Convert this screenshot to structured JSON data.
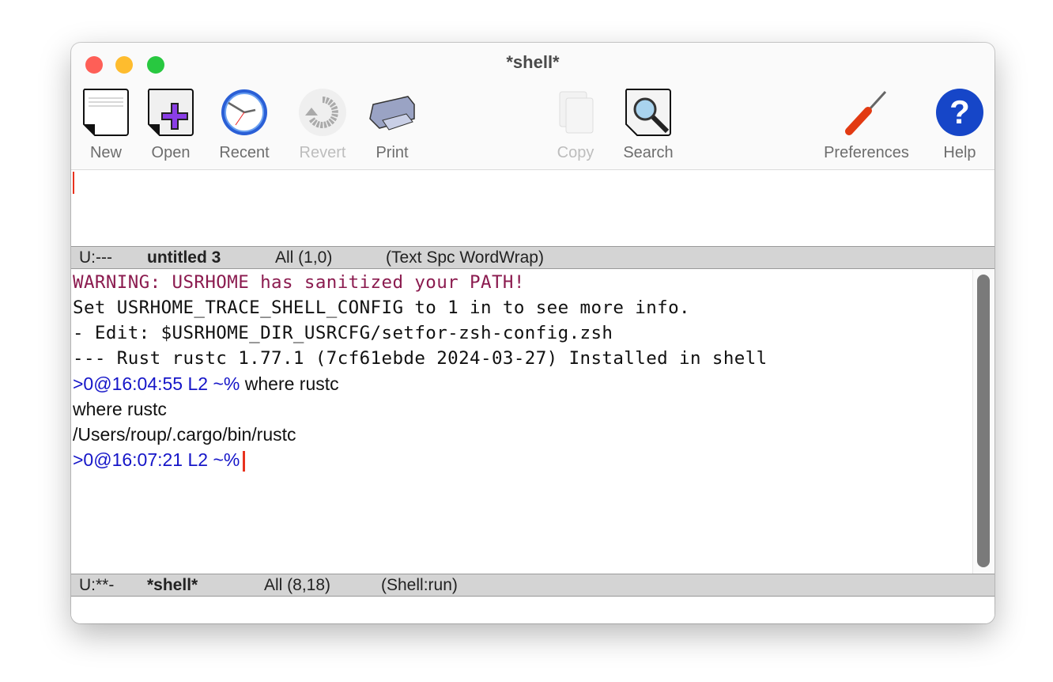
{
  "window": {
    "title": "*shell*"
  },
  "toolbar": {
    "items": [
      {
        "label": "New",
        "icon": "new-file-icon",
        "enabled": true
      },
      {
        "label": "Open",
        "icon": "open-file-icon",
        "enabled": true
      },
      {
        "label": "Recent",
        "icon": "clock-icon",
        "enabled": true
      },
      {
        "label": "Revert",
        "icon": "revert-icon",
        "enabled": false
      },
      {
        "label": "Print",
        "icon": "printer-icon",
        "enabled": true
      },
      {
        "label": "Copy",
        "icon": "copy-icon",
        "enabled": false
      },
      {
        "label": "Search",
        "icon": "magnifier-icon",
        "enabled": true
      },
      {
        "label": "Preferences",
        "icon": "screwdriver-icon",
        "enabled": true
      },
      {
        "label": "Help",
        "icon": "help-icon",
        "enabled": true
      }
    ]
  },
  "modeline_top": {
    "status": "U:---",
    "buffer": "untitled 3",
    "position": "All (1,0)",
    "modes": "(Text Spc WordWrap)"
  },
  "shell": {
    "lines": [
      "WARNING: USRHOME has sanitized your PATH!",
      "Set USRHOME_TRACE_SHELL_CONFIG to 1 in to see more info.",
      "- Edit: $USRHOME_DIR_USRCFG/setfor-zsh-config.zsh",
      "--- Rust rustc 1.77.1 (7cf61ebde 2024-03-27) Installed in shell"
    ],
    "prompt1": ">0@16:04:55 L2 ~%",
    "command1": " where rustc",
    "output": [
      "where rustc",
      "/Users/roup/.cargo/bin/rustc"
    ],
    "prompt2": ">0@16:07:21 L2 ~%"
  },
  "modeline_bottom": {
    "status": "U:**-",
    "buffer": "*shell*",
    "position": "All (8,18)",
    "modes": "(Shell:run)"
  },
  "colors": {
    "warning": "#8b1b4f",
    "prompt": "#1515c8",
    "cursor": "#e8321e"
  }
}
